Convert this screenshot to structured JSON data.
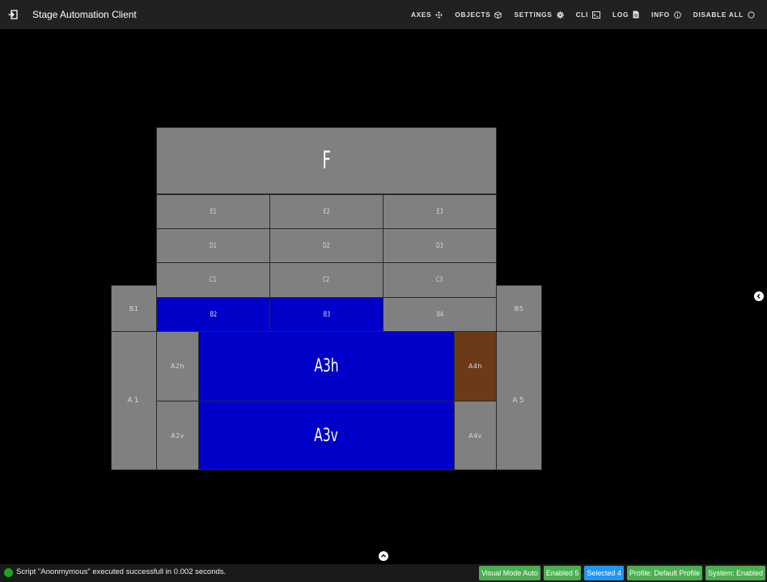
{
  "header": {
    "title": "Stage Automation Client",
    "nav": [
      {
        "label": "AXES",
        "icon": "move-icon"
      },
      {
        "label": "OBJECTS",
        "icon": "cube-icon"
      },
      {
        "label": "SETTINGS",
        "icon": "gear-icon"
      },
      {
        "label": "CLI",
        "icon": "terminal-icon"
      },
      {
        "label": "LOG",
        "icon": "file-icon"
      },
      {
        "label": "INFO",
        "icon": "info-icon"
      },
      {
        "label": "DISABLE ALL",
        "icon": "power-icon"
      }
    ]
  },
  "stage": {
    "F": "F",
    "E1": "E1",
    "E2": "E2",
    "E3": "E3",
    "D1": "D1",
    "D2": "D2",
    "D3": "D3",
    "C1": "C1",
    "C2": "C2",
    "C3": "C3",
    "B1": "B1",
    "B2": "B2",
    "B3": "B3",
    "B4": "B4",
    "B5": "B5",
    "A1": "A1",
    "A2h": "A2h",
    "A2v": "A2v",
    "A3h": "A3h",
    "A3v": "A3v",
    "A4h": "A4h",
    "A4v": "A4v",
    "A5": "A5"
  },
  "colors": {
    "inactive": "#808080",
    "selected": "#0000c8",
    "special": "#6b3a18",
    "status_ok": "#4caf50",
    "selected_badge": "#2196f3"
  },
  "status": {
    "message": "Script \"Anonmymous\" executed successfull in 0.002 seconds.",
    "badges": {
      "visual_mode": "Visual Mode Auto",
      "enabled": "Enabled 5",
      "selected": "Selected 4",
      "profile": "Profile: Default Profile",
      "system": "System: Enabled"
    }
  }
}
